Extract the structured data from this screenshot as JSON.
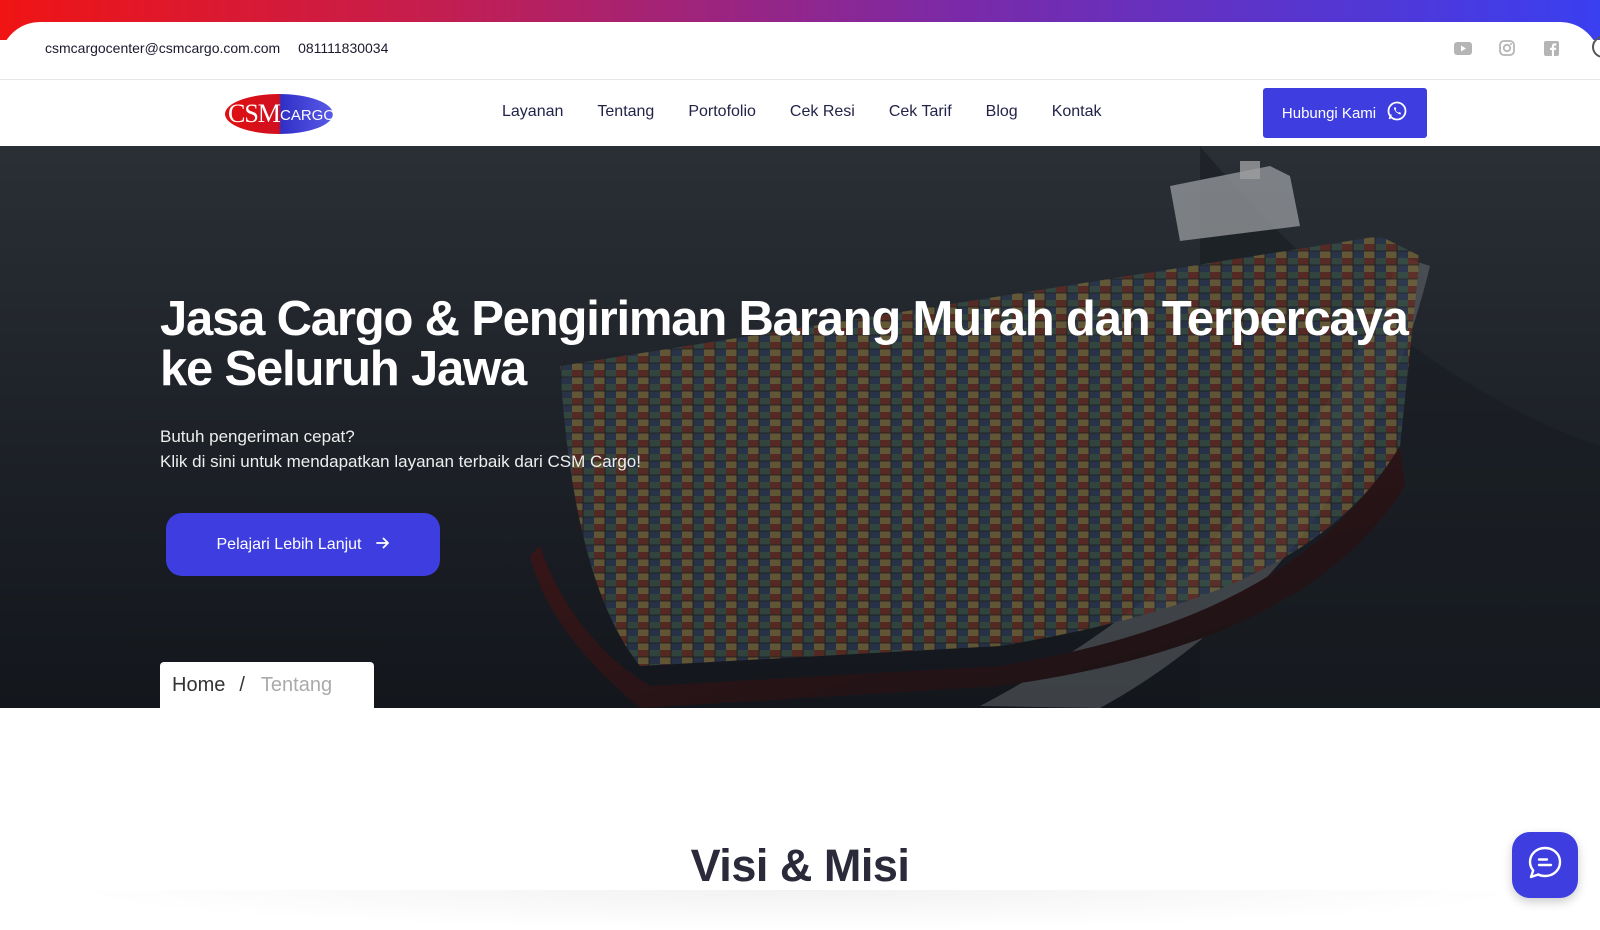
{
  "topbar": {
    "email": "csmcargocenter@csmcargo.com.com",
    "phone": "081111830034",
    "social_icons": [
      "youtube-icon",
      "instagram-icon",
      "facebook-icon"
    ]
  },
  "header": {
    "logo_text_main": "CSM",
    "logo_text_sub": "CARGO",
    "nav": [
      "Layanan",
      "Tentang",
      "Portofolio",
      "Cek Resi",
      "Cek Tarif",
      "Blog",
      "Kontak"
    ],
    "cta_label": "Hubungi Kami",
    "cta_icon": "whatsapp-icon"
  },
  "hero": {
    "title": "Jasa Cargo & Pengiriman Barang Murah dan Terpercaya ke Seluruh Jawa",
    "subtitle_line1": "Butuh pengeriman cepat?",
    "subtitle_line2": "Klik di sini untuk mendapatkan layanan terbaik dari CSM Cargo!",
    "button_label": "Pelajari Lebih Lanjut",
    "button_icon": "arrow-right-icon"
  },
  "breadcrumb": {
    "home": "Home",
    "separator": "/",
    "current": "Tentang"
  },
  "section": {
    "title": "Visi & Misi"
  },
  "colors": {
    "accent": "#3d3de0",
    "gradient_start": "#f01414",
    "gradient_end": "#3a3ff0"
  }
}
